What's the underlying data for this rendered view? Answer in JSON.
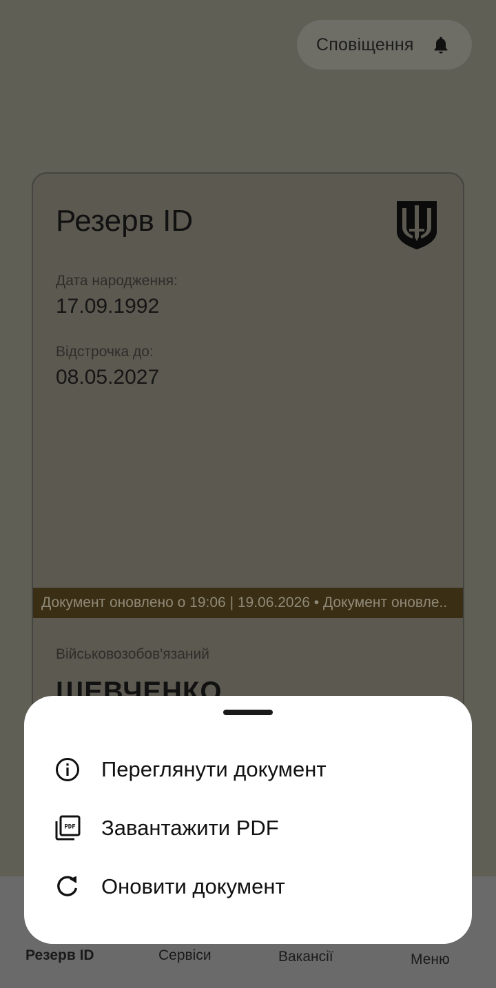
{
  "header": {
    "notifications_label": "Сповіщення",
    "notifications_icon": "bell-icon"
  },
  "card": {
    "title": "Резерв ID",
    "emblem_icon": "trident-emblem-icon",
    "birth_date_label": "Дата народження:",
    "birth_date_value": "17.09.1992",
    "deferral_label": "Відстрочка до:",
    "deferral_value": "08.05.2027",
    "ticker_text": "Документ оновлено о 19:06 | 19.06.2026 • Документ оновле..",
    "status_label": "Військовозобов'язаний",
    "surname": "ШЕВЧЕНКО"
  },
  "sheet": {
    "items": [
      {
        "label": "Переглянути документ",
        "icon": "info-icon"
      },
      {
        "label": "Завантажити PDF",
        "icon": "pdf-icon"
      },
      {
        "label": "Оновити документ",
        "icon": "refresh-icon"
      }
    ]
  },
  "bottom_nav": {
    "items": [
      {
        "label": "Резерв ID"
      },
      {
        "label": "Сервіси"
      },
      {
        "label": "Вакансії"
      },
      {
        "label": "Меню"
      }
    ]
  },
  "colors": {
    "overlay_bg": "#5f5f56",
    "ticker_bg": "#3a2e14",
    "sheet_bg": "#ffffff"
  }
}
